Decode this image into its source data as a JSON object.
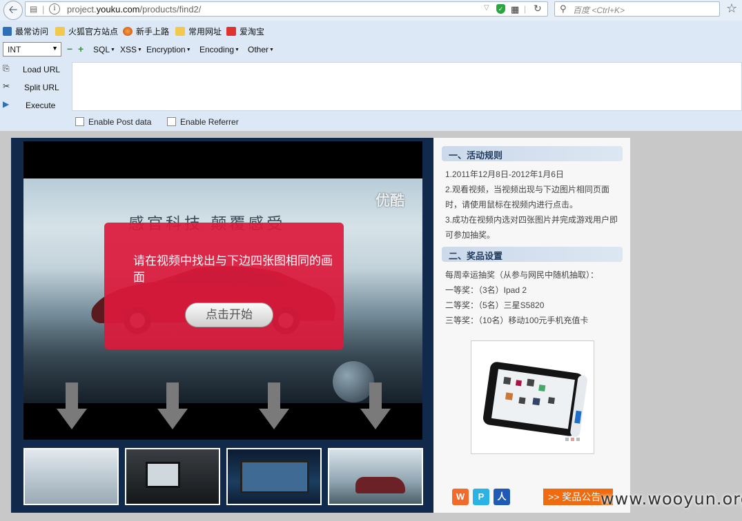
{
  "browser": {
    "url_prefix": "project.",
    "url_domain": "youku.com",
    "url_path": "/products/find2/",
    "search_placeholder": "百度 <Ctrl+K>"
  },
  "bookmarks": [
    {
      "label": "最常访问",
      "icon": "frequent-icon"
    },
    {
      "label": "火狐官方站点",
      "icon": "folder-icon"
    },
    {
      "label": "新手上路",
      "icon": "firefox-icon"
    },
    {
      "label": "常用网址",
      "icon": "folder-icon"
    },
    {
      "label": "爱淘宝",
      "icon": "taobao-icon"
    }
  ],
  "hackbar": {
    "type_select": "INT",
    "menus": [
      "SQL",
      "XSS",
      "Encryption",
      "Encoding",
      "Other"
    ],
    "tools": [
      "Load URL",
      "Split URL",
      "Execute"
    ],
    "checkboxes": [
      "Enable Post data",
      "Enable Referrer"
    ]
  },
  "video": {
    "slogan": "感官科技 颠覆感受",
    "logo": "优酷",
    "message": "请在视频中找出与下边四张图相同的画面",
    "start_button": "点击开始"
  },
  "sidebar": {
    "rules_title": "一、活动规则",
    "rules": [
      "1.2011年12月8日-2012年1月6日",
      "2.观看视频，当视频出现与下边图片相同页面",
      "时，请使用鼠标在视频内进行点击。",
      "3.成功在视频内选对四张图片并完成游戏用户即",
      "可参加抽奖。"
    ],
    "prizes_title": "二、奖品设置",
    "prizes": [
      "每周幸运抽奖（从参与网民中随机抽取）：",
      "一等奖：（3名）Ipad 2",
      "二等奖：（5名）三星S5820",
      "三等奖：（10名）移动100元手机充值卡"
    ],
    "notice_button": ">> 奖品公告"
  },
  "watermark": "www.wooyun.org",
  "colors": {
    "overlay": "#dc193c",
    "page_bg": "#11294a",
    "notice": "#f06a0f"
  }
}
